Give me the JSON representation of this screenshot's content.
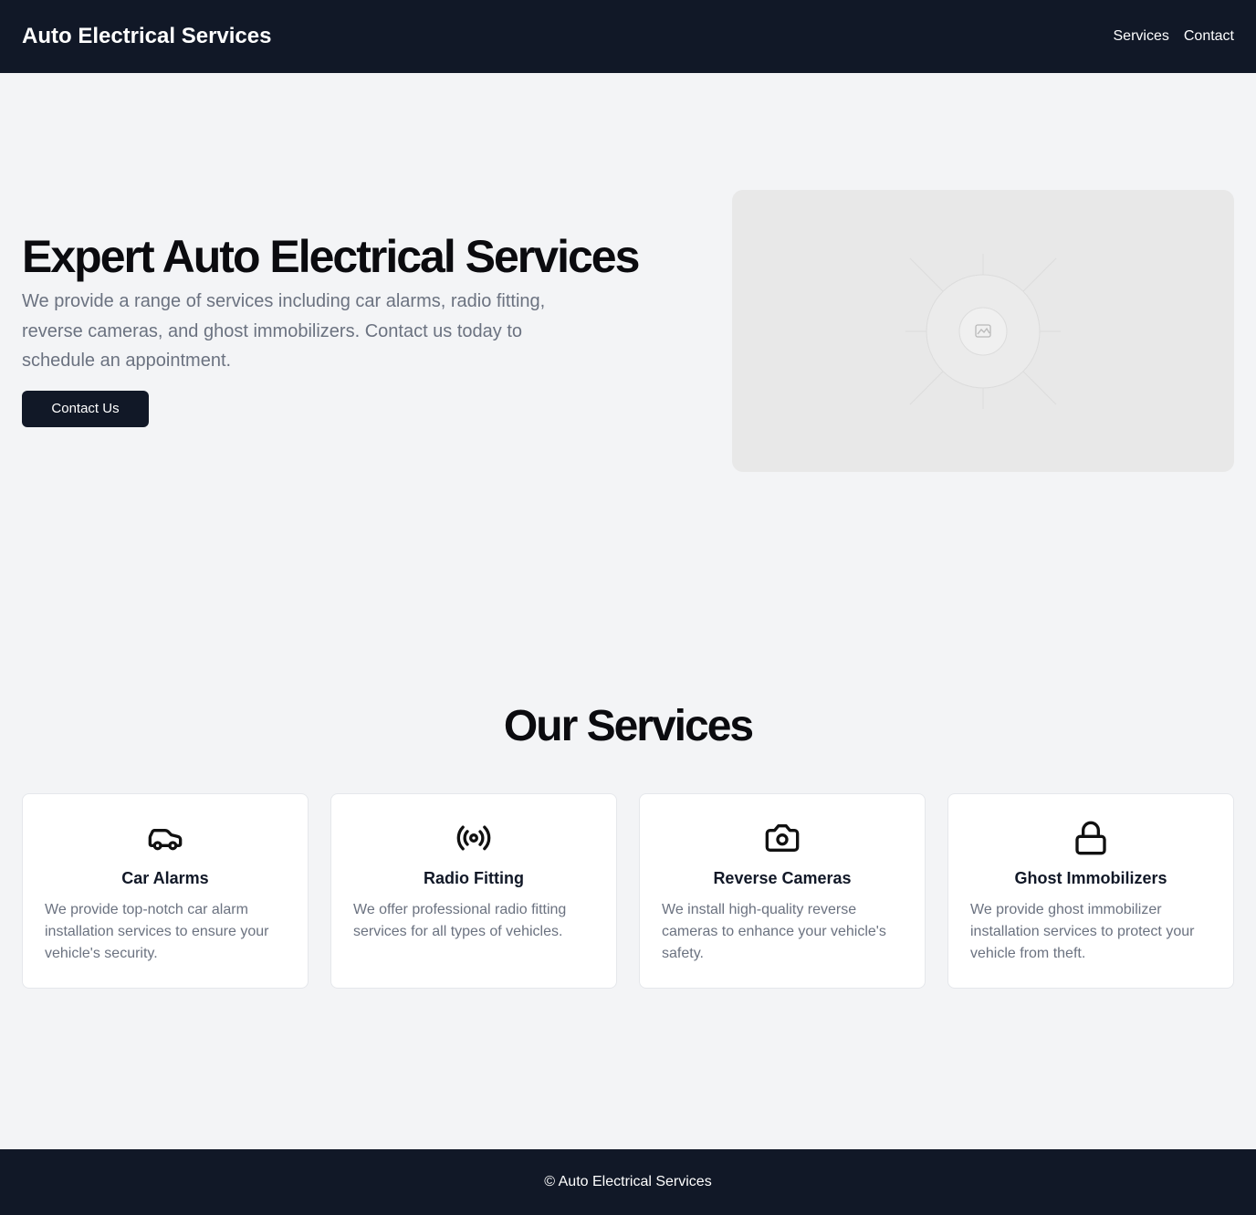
{
  "header": {
    "brand": "Auto Electrical Services",
    "nav": [
      {
        "label": "Services"
      },
      {
        "label": "Contact"
      }
    ]
  },
  "hero": {
    "title": "Expert Auto Electrical Services",
    "description": "We provide a range of services including car alarms, radio fitting, reverse cameras, and ghost immobilizers. Contact us today to schedule an appointment.",
    "cta_label": "Contact Us",
    "image_icon": "image-placeholder-icon"
  },
  "services": {
    "title": "Our Services",
    "items": [
      {
        "icon": "car-icon",
        "title": "Car Alarms",
        "description": "We provide top-notch car alarm installation services to ensure your vehicle's security."
      },
      {
        "icon": "radio-icon",
        "title": "Radio Fitting",
        "description": "We offer professional radio fitting services for all types of vehicles."
      },
      {
        "icon": "camera-icon",
        "title": "Reverse Cameras",
        "description": "We install high-quality reverse cameras to enhance your vehicle's safety."
      },
      {
        "icon": "lock-icon",
        "title": "Ghost Immobilizers",
        "description": "We provide ghost immobilizer installation services to protect your vehicle from theft."
      }
    ]
  },
  "footer": {
    "text": "© Auto Electrical Services"
  },
  "colors": {
    "dark": "#111827",
    "background": "#f3f4f6",
    "muted_text": "#6b7280",
    "card": "#ffffff"
  }
}
